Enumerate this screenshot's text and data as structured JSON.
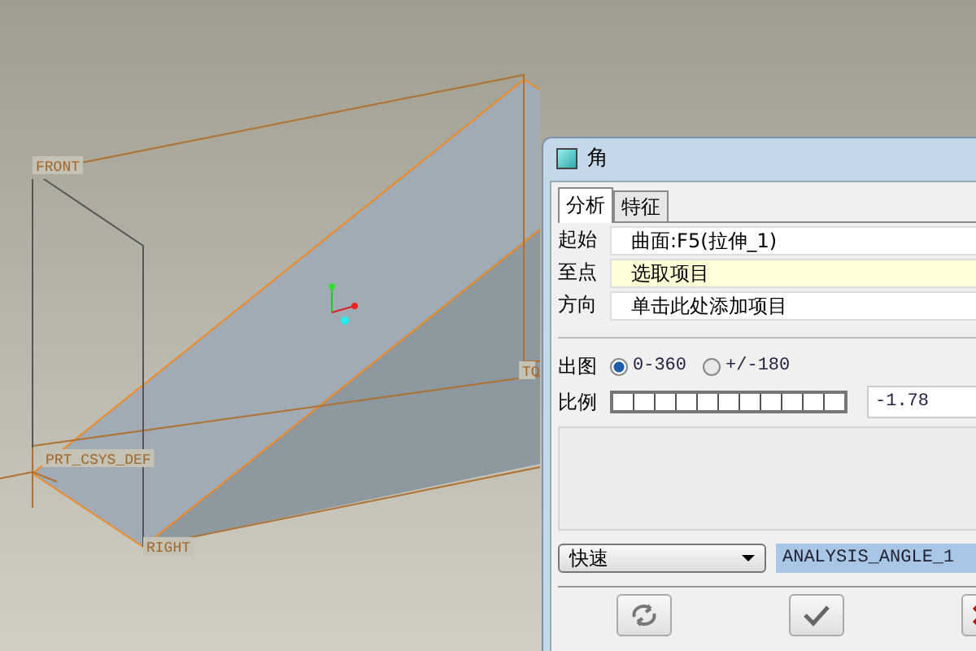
{
  "viewport": {
    "labels": [
      {
        "kind": "front",
        "text": "FRONT"
      },
      {
        "kind": "csys",
        "text": "PRT_CSYS_DEF"
      },
      {
        "kind": "right",
        "text": "RIGHT"
      },
      {
        "kind": "top",
        "text": "TO"
      }
    ]
  },
  "dialog": {
    "title": "角",
    "tabs": [
      {
        "label": "分析",
        "selected": true
      },
      {
        "label": "特征",
        "selected": false
      }
    ],
    "fields": [
      {
        "label": "起始",
        "value": "曲面:F5(拉伸_1)",
        "active": false
      },
      {
        "label": "至点",
        "value": "选取项目",
        "active": true
      },
      {
        "label": "方向",
        "value": "单击此处添加项目",
        "active": false
      }
    ],
    "output": {
      "label": "出图",
      "options": [
        {
          "label": "0-360",
          "selected": true
        },
        {
          "label": "+/-180",
          "selected": false
        }
      ]
    },
    "scale": {
      "label": "比例",
      "value": "-1.78"
    },
    "quality": {
      "value": "快速"
    },
    "name": {
      "value": "ANALYSIS_ANGLE_1"
    },
    "buttons": [
      {
        "kind": "repeat"
      },
      {
        "kind": "ok"
      },
      {
        "kind": "cancel"
      }
    ]
  }
}
